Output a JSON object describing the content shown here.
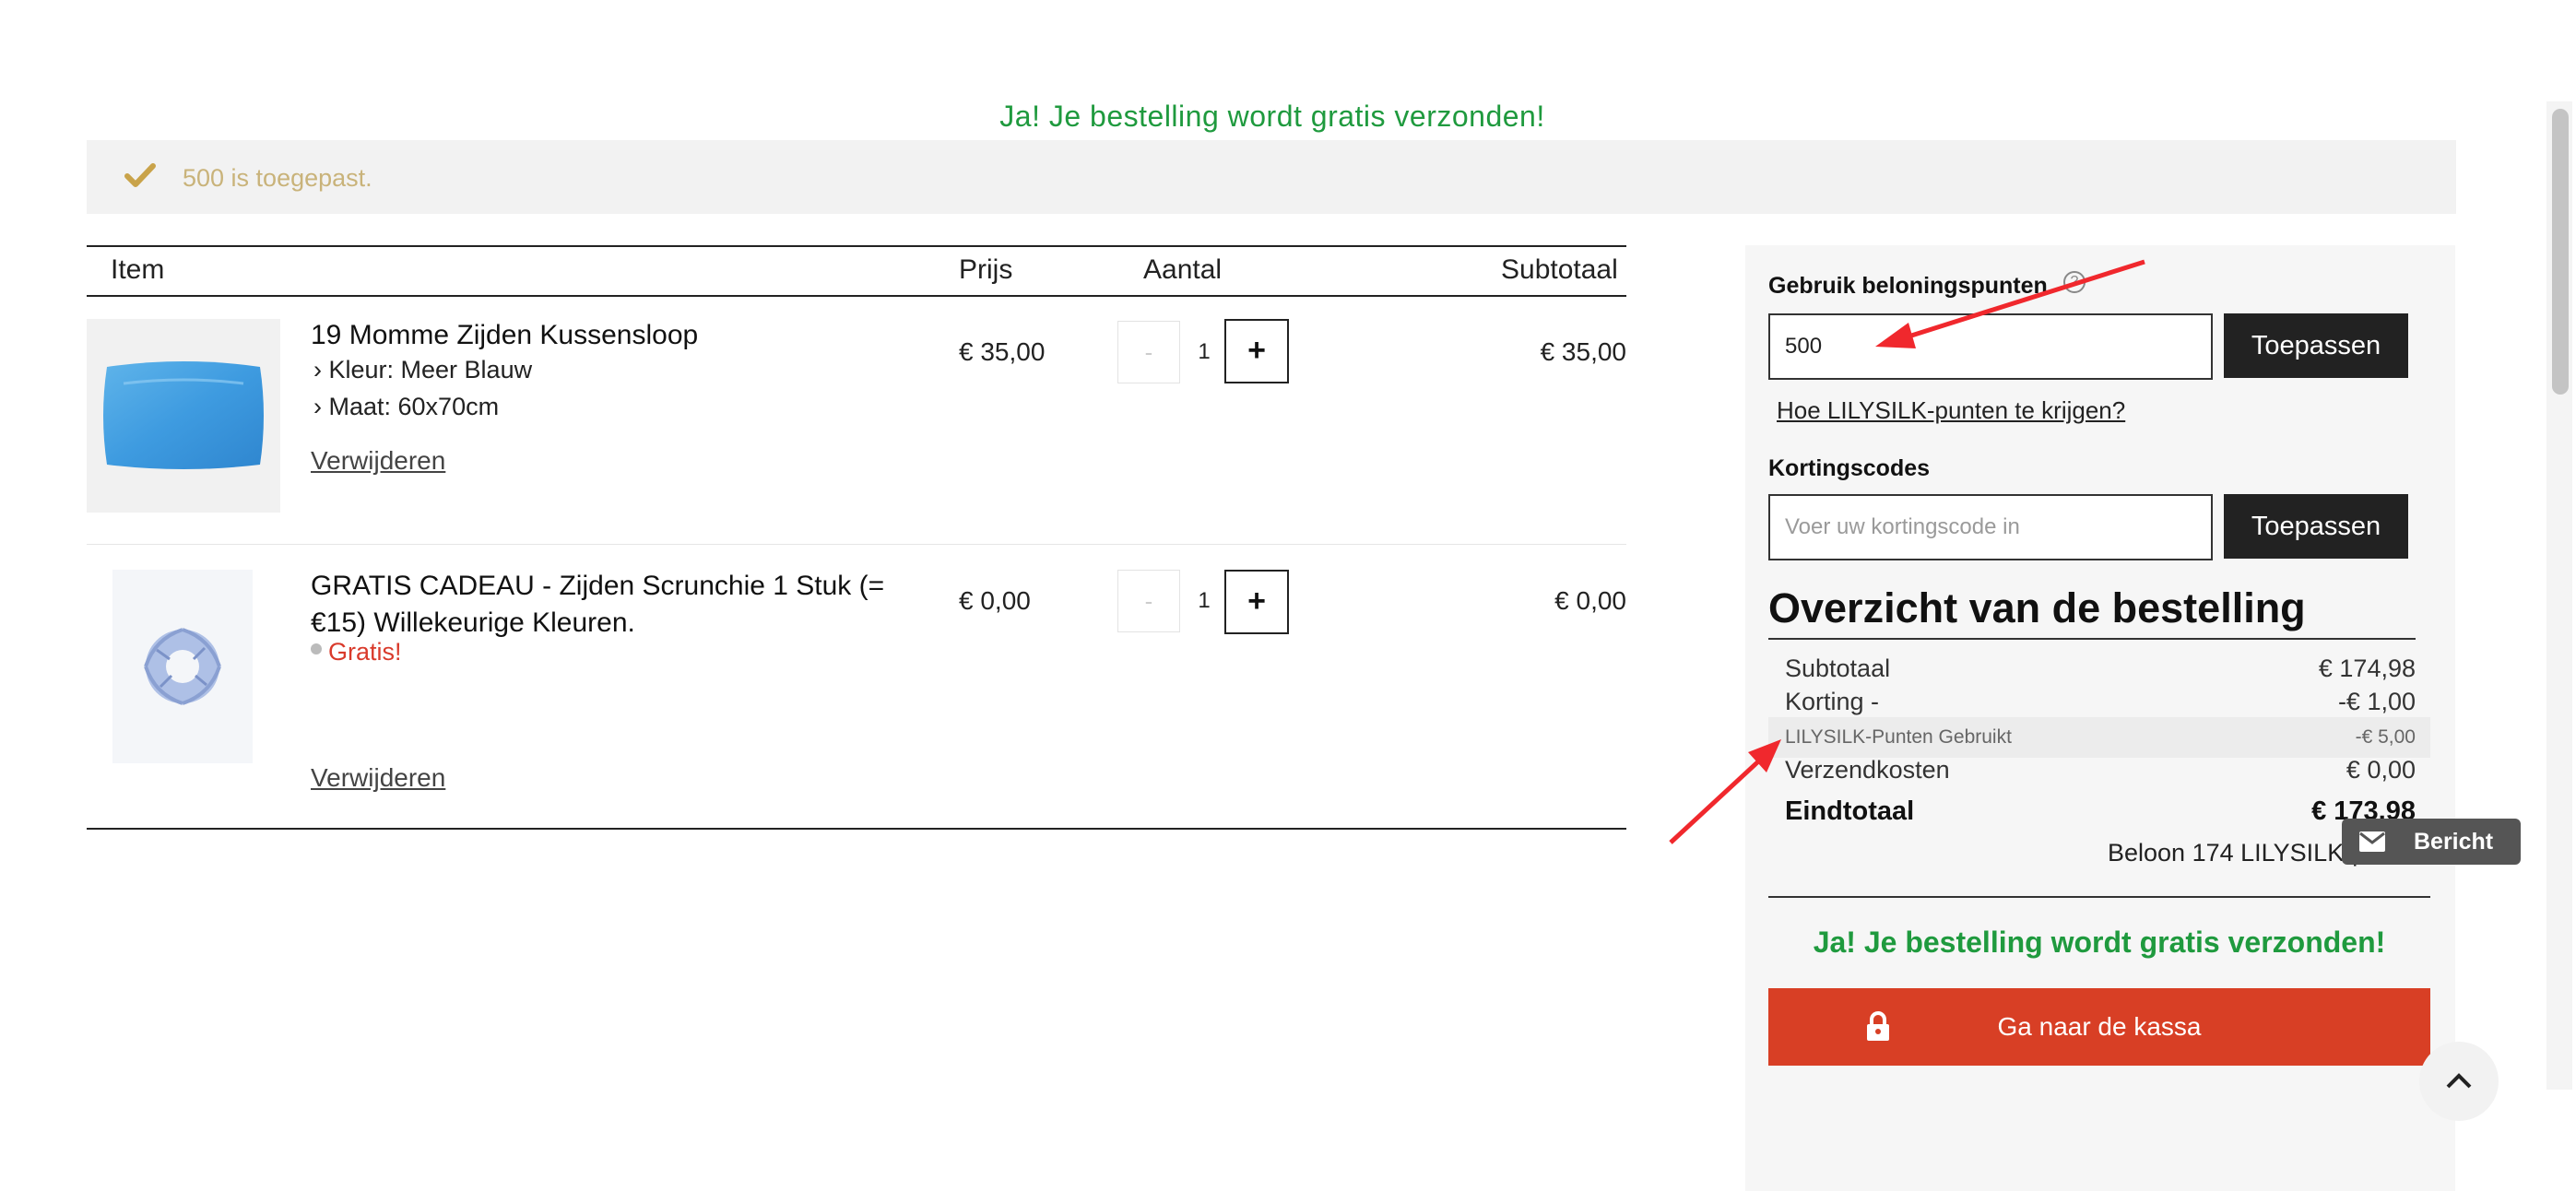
{
  "banner": {
    "free_shipping": "Ja! Je bestelling wordt gratis verzonden!"
  },
  "notice": {
    "message": "500 is toegepast."
  },
  "table": {
    "headers": {
      "item": "Item",
      "price": "Prijs",
      "qty": "Aantal",
      "subtotal": "Subtotaal"
    },
    "rows": [
      {
        "name": "19 Momme Zijden Kussensloop",
        "attr1": "› Kleur:  Meer Blauw",
        "attr2": "› Maat:  60x70cm",
        "remove": "Verwijderen",
        "price": "€ 35,00",
        "qty": "1",
        "subtotal": "€ 35,00",
        "qty_minus": "-",
        "qty_plus": "+"
      },
      {
        "name_line1": "GRATIS CADEAU - Zijden Scrunchie 1 Stuk (=",
        "name_line2": "€15) Willekeurige Kleuren.",
        "gratis": "Gratis!",
        "remove": "Verwijderen",
        "price": "€ 0,00",
        "qty": "1",
        "subtotal": "€ 0,00",
        "qty_minus": "-",
        "qty_plus": "+"
      }
    ]
  },
  "sidebar": {
    "points_label": "Gebruik beloningspunten",
    "points_value": "500",
    "apply": "Toepassen",
    "points_link": "Hoe LILYSILK-punten te krijgen?",
    "coupon_label": "Kortingscodes",
    "coupon_placeholder": "Voer uw kortingscode in",
    "coupon_apply": "Toepassen",
    "summary_title": "Overzicht van de bestelling",
    "summary": {
      "subtotal_label": "Subtotaal",
      "subtotal": "€ 174,98",
      "discount_label": "Korting -",
      "discount": "-€ 1,00",
      "points_label": "LILYSILK-Punten Gebruikt",
      "points": "-€ 5,00",
      "shipping_label": "Verzendkosten",
      "shipping": "€ 0,00",
      "total_label": "Eindtotaal",
      "total": "€ 173,98",
      "reward": "Beloon 174 LILYSILK-p"
    },
    "free_shipping": "Ja! Je bestelling wordt gratis verzonden!",
    "checkout": "Ga naar de kassa"
  },
  "chat": {
    "label": "Bericht"
  },
  "colors": {
    "accent_green": "#1f9a3e",
    "checkout_red": "#d83f25",
    "notice_gold": "#c9b37a",
    "annotation_red": "#f0282d"
  }
}
